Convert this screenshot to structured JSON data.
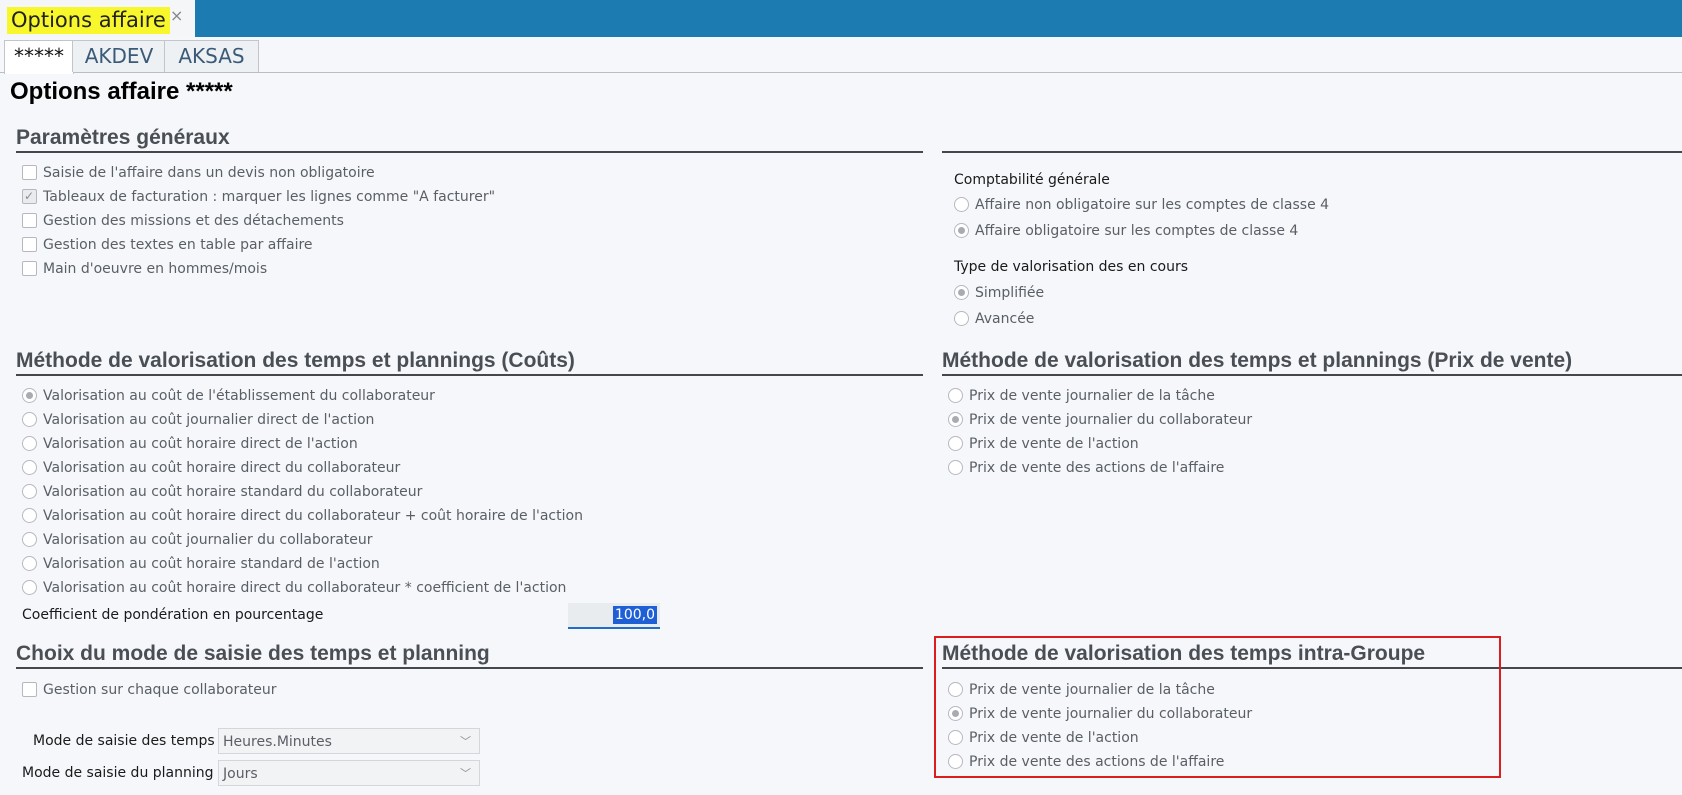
{
  "window": {
    "tab_title": "Options affaire",
    "close": "×"
  },
  "subtabs": [
    "*****",
    "AKDEV",
    "AKSAS"
  ],
  "page_title": "Options affaire *****",
  "general": {
    "title": "Paramètres généraux",
    "items": [
      {
        "label": "Saisie de l'affaire dans un devis non obligatoire",
        "checked": false
      },
      {
        "label": "Tableaux de facturation : marquer les lignes comme \"A facturer\"",
        "checked": true
      },
      {
        "label": "Gestion des missions et des détachements",
        "checked": false
      },
      {
        "label": "Gestion des textes en table par affaire",
        "checked": false
      },
      {
        "label": "Main d'oeuvre en hommes/mois",
        "checked": false
      }
    ]
  },
  "accounting": {
    "title": "Comptabilité générale",
    "options": [
      "Affaire non obligatoire sur les comptes de classe 4",
      "Affaire obligatoire sur les comptes de classe 4"
    ],
    "selected": 1
  },
  "wip": {
    "title": "Type de valorisation des en cours",
    "options": [
      "Simplifiée",
      "Avancée"
    ],
    "selected": 0
  },
  "costs": {
    "title": "Méthode de valorisation des temps et plannings (Coûts)",
    "options": [
      "Valorisation au coût de l'établissement du collaborateur",
      "Valorisation au coût journalier direct de l'action",
      "Valorisation au coût horaire direct de l'action",
      "Valorisation au coût horaire direct du collaborateur",
      "Valorisation au coût horaire standard du collaborateur",
      "Valorisation au coût horaire direct du collaborateur + coût horaire de l'action",
      "Valorisation au coût journalier du collaborateur",
      "Valorisation au coût horaire standard de l'action",
      "Valorisation au coût horaire direct du collaborateur * coefficient de l'action"
    ],
    "selected": 0,
    "coef_label": "Coefficient de pondération en pourcentage",
    "coef_value": "100,0"
  },
  "sale": {
    "title": "Méthode de valorisation des temps et plannings (Prix de vente)",
    "options": [
      "Prix de vente journalier de la tâche",
      "Prix de vente journalier du collaborateur",
      "Prix de vente de l'action",
      "Prix de vente des actions de l'affaire"
    ],
    "selected": 1
  },
  "entry": {
    "title": "Choix du mode de saisie des temps et planning",
    "checkbox": "Gestion sur chaque collaborateur",
    "time_label": "Mode de saisie des temps",
    "time_value": "Heures.Minutes",
    "plan_label": "Mode de saisie du planning",
    "plan_value": "Jours"
  },
  "intra": {
    "title": "Méthode de valorisation des temps intra-Groupe",
    "options": [
      "Prix de vente journalier de la tâche",
      "Prix de vente journalier du collaborateur",
      "Prix de vente de l'action",
      "Prix de vente des actions de l'affaire"
    ],
    "selected": 1,
    "highlight_color": "#d81e1e"
  }
}
